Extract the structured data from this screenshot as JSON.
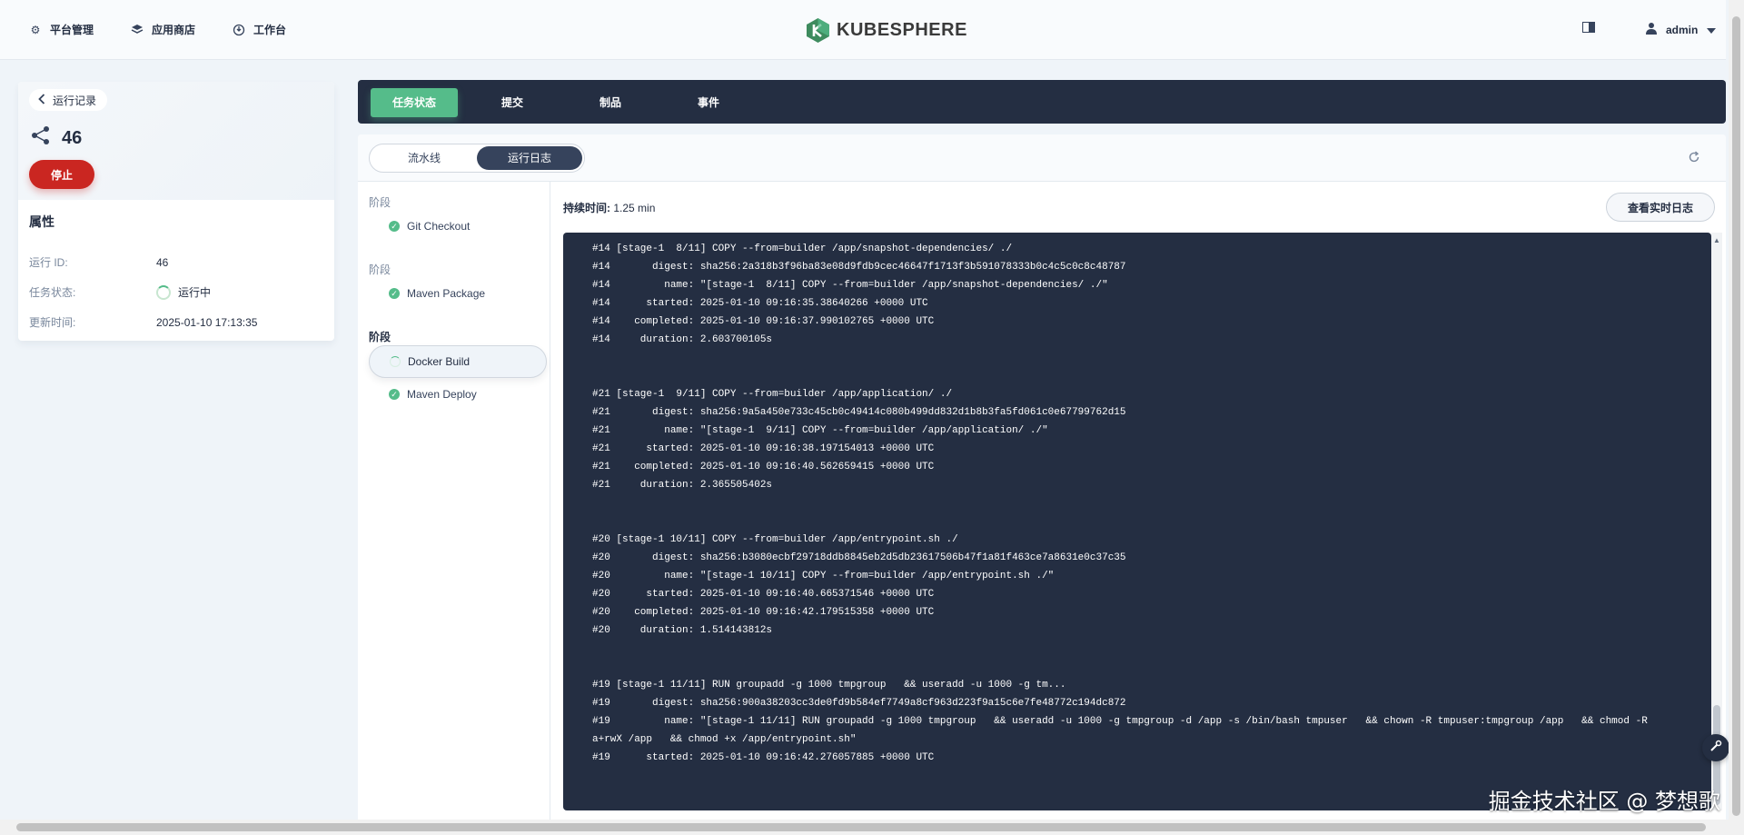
{
  "nav": {
    "items": [
      {
        "label": "平台管理",
        "icon": "gear-icon"
      },
      {
        "label": "应用商店",
        "icon": "app-store-icon"
      },
      {
        "label": "工作台",
        "icon": "workbench-icon"
      }
    ],
    "logo_text": "KUBESPHERE",
    "user": "admin"
  },
  "left": {
    "back_label": "运行记录",
    "run_number": "46",
    "stop_label": "停止",
    "attr_title": "属性",
    "attrs": [
      {
        "key": "运行 ID:",
        "value": "46"
      },
      {
        "key": "任务状态:",
        "value": "运行中"
      },
      {
        "key": "更新时间:",
        "value": "2025-01-10 17:13:35"
      }
    ]
  },
  "tabs": [
    "任务状态",
    "提交",
    "制品",
    "事件"
  ],
  "segments": [
    "流水线",
    "运行日志"
  ],
  "stages": {
    "label": "阶段",
    "items": [
      {
        "name": "Git Checkout",
        "status": "success"
      },
      {
        "name": "Maven Package",
        "status": "success"
      },
      {
        "name": "Docker Build",
        "status": "running"
      },
      {
        "name": "Maven Deploy",
        "status": "success"
      }
    ]
  },
  "duration": {
    "label": "持续时间:",
    "value": "1.25 min"
  },
  "live_log_label": "查看实时日志",
  "log_lines": [
    "#14 [stage-1  8/11] COPY --from=builder /app/snapshot-dependencies/ ./",
    "#14       digest: sha256:2a318b3f96ba83e08d9fdb9cec46647f1713f3b591078333b0c4c5c0c8c48787",
    "#14         name: \"[stage-1  8/11] COPY --from=builder /app/snapshot-dependencies/ ./\"",
    "#14      started: 2025-01-10 09:16:35.38640266 +0000 UTC",
    "#14    completed: 2025-01-10 09:16:37.990102765 +0000 UTC",
    "#14     duration: 2.603700105s",
    "",
    "#21 [stage-1  9/11] COPY --from=builder /app/application/ ./",
    "#21       digest: sha256:9a5a450e733c45cb0c49414c080b499dd832d1b8b3fa5fd061c0e67799762d15",
    "#21         name: \"[stage-1  9/11] COPY --from=builder /app/application/ ./\"",
    "#21      started: 2025-01-10 09:16:38.197154013 +0000 UTC",
    "#21    completed: 2025-01-10 09:16:40.562659415 +0000 UTC",
    "#21     duration: 2.365505402s",
    "",
    "#20 [stage-1 10/11] COPY --from=builder /app/entrypoint.sh ./",
    "#20       digest: sha256:b3080ecbf29718ddb8845eb2d5db23617506b47f1a81f463ce7a8631e0c37c35",
    "#20         name: \"[stage-1 10/11] COPY --from=builder /app/entrypoint.sh ./\"",
    "#20      started: 2025-01-10 09:16:40.665371546 +0000 UTC",
    "#20    completed: 2025-01-10 09:16:42.179515358 +0000 UTC",
    "#20     duration: 1.514143812s",
    "",
    "#19 [stage-1 11/11] RUN groupadd -g 1000 tmpgroup   && useradd -u 1000 -g tm...",
    "#19       digest: sha256:900a38203cc3de0fd9b584ef7749a8cf963d223f9a15c6e7fe48772c194dc872",
    "#19         name: \"[stage-1 11/11] RUN groupadd -g 1000 tmpgroup   && useradd -u 1000 -g tmpgroup -d /app -s /bin/bash tmpuser   && chown -R tmpuser:tmpgroup /app   && chmod -R",
    "a+rwX /app   && chmod +x /app/entrypoint.sh\"",
    "#19      started: 2025-01-10 09:16:42.276057885 +0000 UTC"
  ],
  "watermark": "掘金技术社区 @ 梦想歌",
  "colors": {
    "accent": "#55bc8a",
    "dark": "#242e42",
    "danger": "#ca2621"
  }
}
